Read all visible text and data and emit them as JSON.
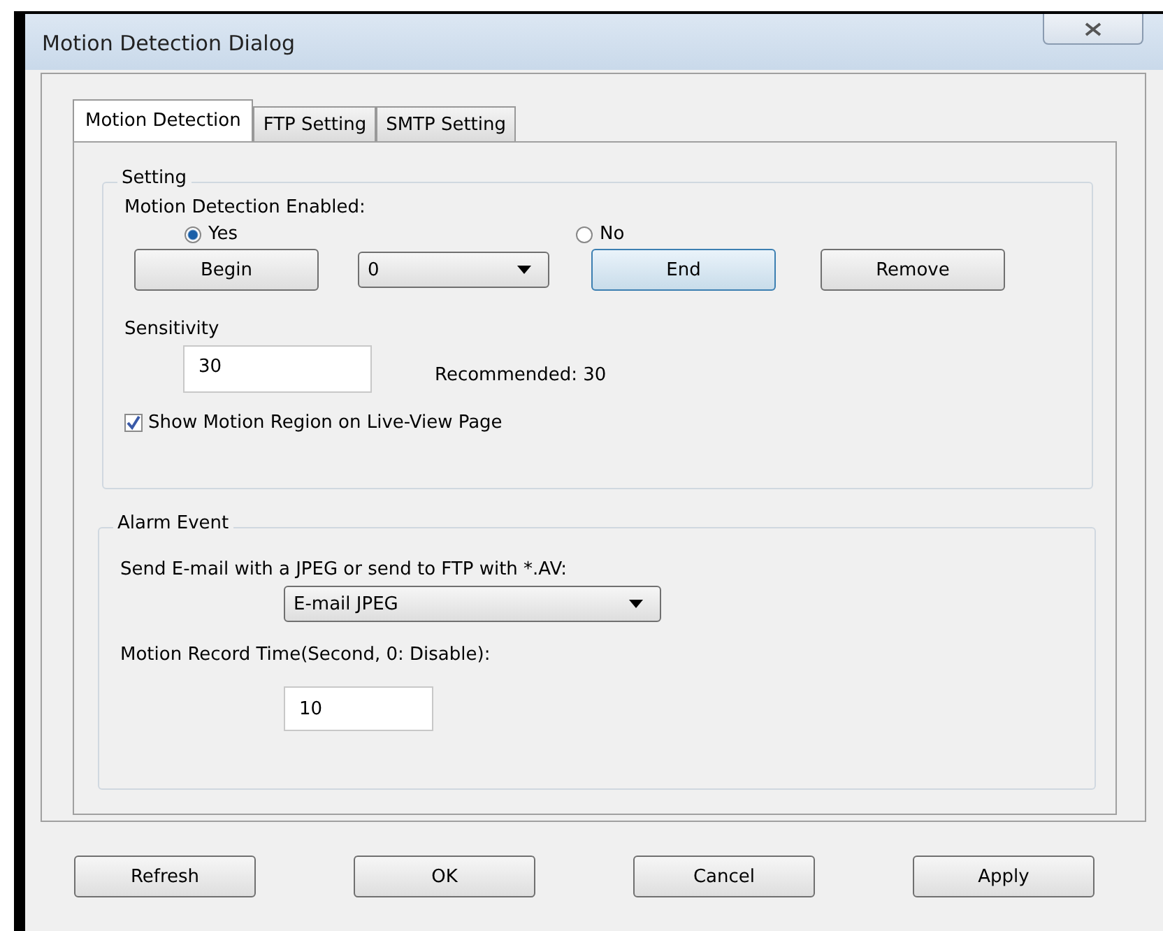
{
  "window": {
    "title": "Motion Detection Dialog"
  },
  "tabs": [
    {
      "label": "Motion Detection",
      "selected": true
    },
    {
      "label": "FTP Setting",
      "selected": false
    },
    {
      "label": "SMTP Setting",
      "selected": false
    }
  ],
  "setting": {
    "title": "Setting",
    "enabled_label": "Motion Detection Enabled:",
    "radios": [
      {
        "label": "Yes",
        "selected": true
      },
      {
        "label": "No",
        "selected": false
      }
    ],
    "controls": [
      {
        "kind": "button",
        "label": "Begin",
        "focused": false
      },
      {
        "kind": "dropdown",
        "value": "0"
      },
      {
        "kind": "button",
        "label": "End",
        "focused": true
      },
      {
        "kind": "button",
        "label": "Remove",
        "focused": false
      }
    ],
    "sensitivity_label": "Sensitivity",
    "sensitivity_value": "30",
    "recommended": "Recommended: 30",
    "checkbox": {
      "label": "Show Motion Region on Live-View Page",
      "checked": true
    }
  },
  "alarm": {
    "title": "Alarm Event",
    "send_label": "Send E-mail with a JPEG or send to FTP with *.AV:",
    "send_value": "E-mail JPEG",
    "record_label": "Motion Record Time(Second, 0: Disable):",
    "record_value": "10"
  },
  "buttons": [
    "Refresh",
    "OK",
    "Cancel",
    "Apply"
  ]
}
